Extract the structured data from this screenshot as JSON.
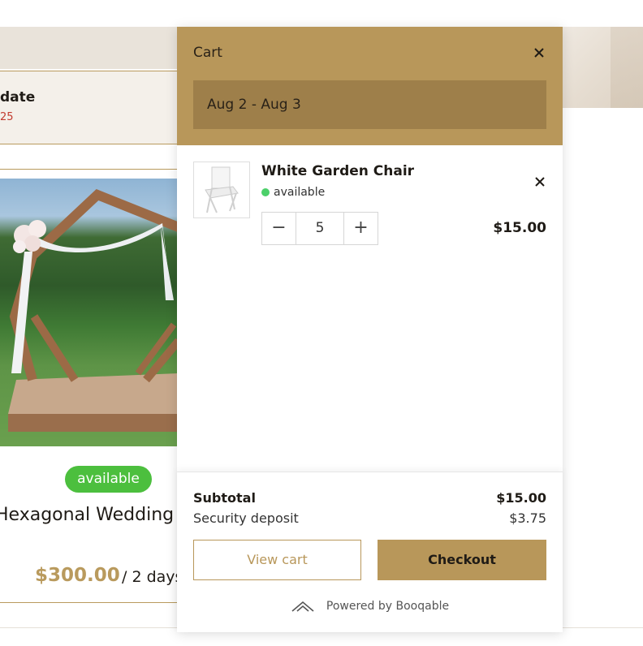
{
  "background": {
    "date_label": "date",
    "date_sub": "25",
    "product": {
      "badge": "available",
      "title": "Hexagonal Wedding",
      "price": "$300.00",
      "per": "/ 2 days"
    }
  },
  "cart": {
    "title": "Cart",
    "close_icon": "close-icon",
    "date_range": "Aug 2 - Aug 3",
    "items": [
      {
        "name": "White Garden Chair",
        "status": "available",
        "status_color": "#4cd06a",
        "quantity": "5",
        "price": "$15.00",
        "minus": "−",
        "plus": "+",
        "remove": "×"
      }
    ],
    "summary": {
      "subtotal_label": "Subtotal",
      "subtotal_value": "$15.00",
      "deposit_label": "Security deposit",
      "deposit_value": "$3.75"
    },
    "buttons": {
      "view_cart": "View cart",
      "checkout": "Checkout"
    },
    "powered_by": "Powered by Booqable"
  },
  "colors": {
    "accent": "#b8975a",
    "accent_dark": "#9e7f4a",
    "available_green": "#4cbf3e"
  }
}
